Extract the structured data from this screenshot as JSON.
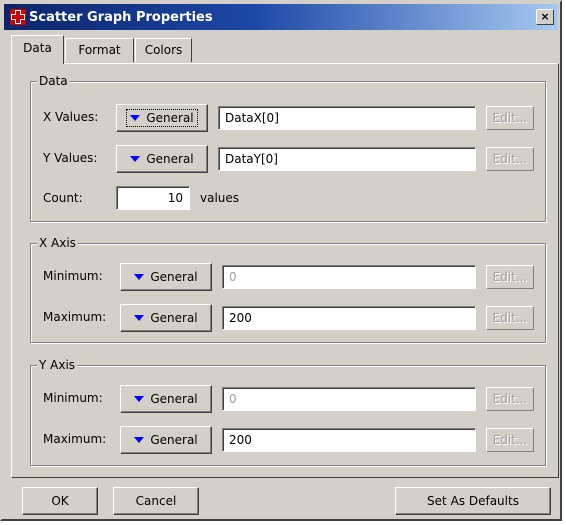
{
  "window": {
    "title": "Scatter Graph Properties",
    "close_glyph": "×"
  },
  "tabs": [
    {
      "label": "Data",
      "active": true
    },
    {
      "label": "Format",
      "active": false
    },
    {
      "label": "Colors",
      "active": false
    }
  ],
  "data_group": {
    "legend": "Data",
    "x_values": {
      "label": "X Values:",
      "mode": "General",
      "value": "DataX[0]",
      "edit": "Edit..."
    },
    "y_values": {
      "label": "Y Values:",
      "mode": "General",
      "value": "DataY[0]",
      "edit": "Edit..."
    },
    "count": {
      "label": "Count:",
      "value": "10",
      "unit": "values"
    }
  },
  "x_axis_group": {
    "legend": "X Axis",
    "minimum": {
      "label": "Minimum:",
      "mode": "General",
      "value": "0",
      "edit": "Edit..."
    },
    "maximum": {
      "label": "Maximum:",
      "mode": "General",
      "value": "200",
      "edit": "Edit..."
    }
  },
  "y_axis_group": {
    "legend": "Y Axis",
    "minimum": {
      "label": "Minimum:",
      "mode": "General",
      "value": "0",
      "edit": "Edit..."
    },
    "maximum": {
      "label": "Maximum:",
      "mode": "General",
      "value": "200",
      "edit": "Edit..."
    }
  },
  "footer": {
    "ok": "OK",
    "cancel": "Cancel",
    "set_defaults": "Set As Defaults"
  },
  "colors": {
    "titlebar_start": "#0a246a",
    "titlebar_end": "#a6caf0",
    "dialog_face": "#d4d0c8",
    "dropdown_arrow": "#0000ff"
  }
}
